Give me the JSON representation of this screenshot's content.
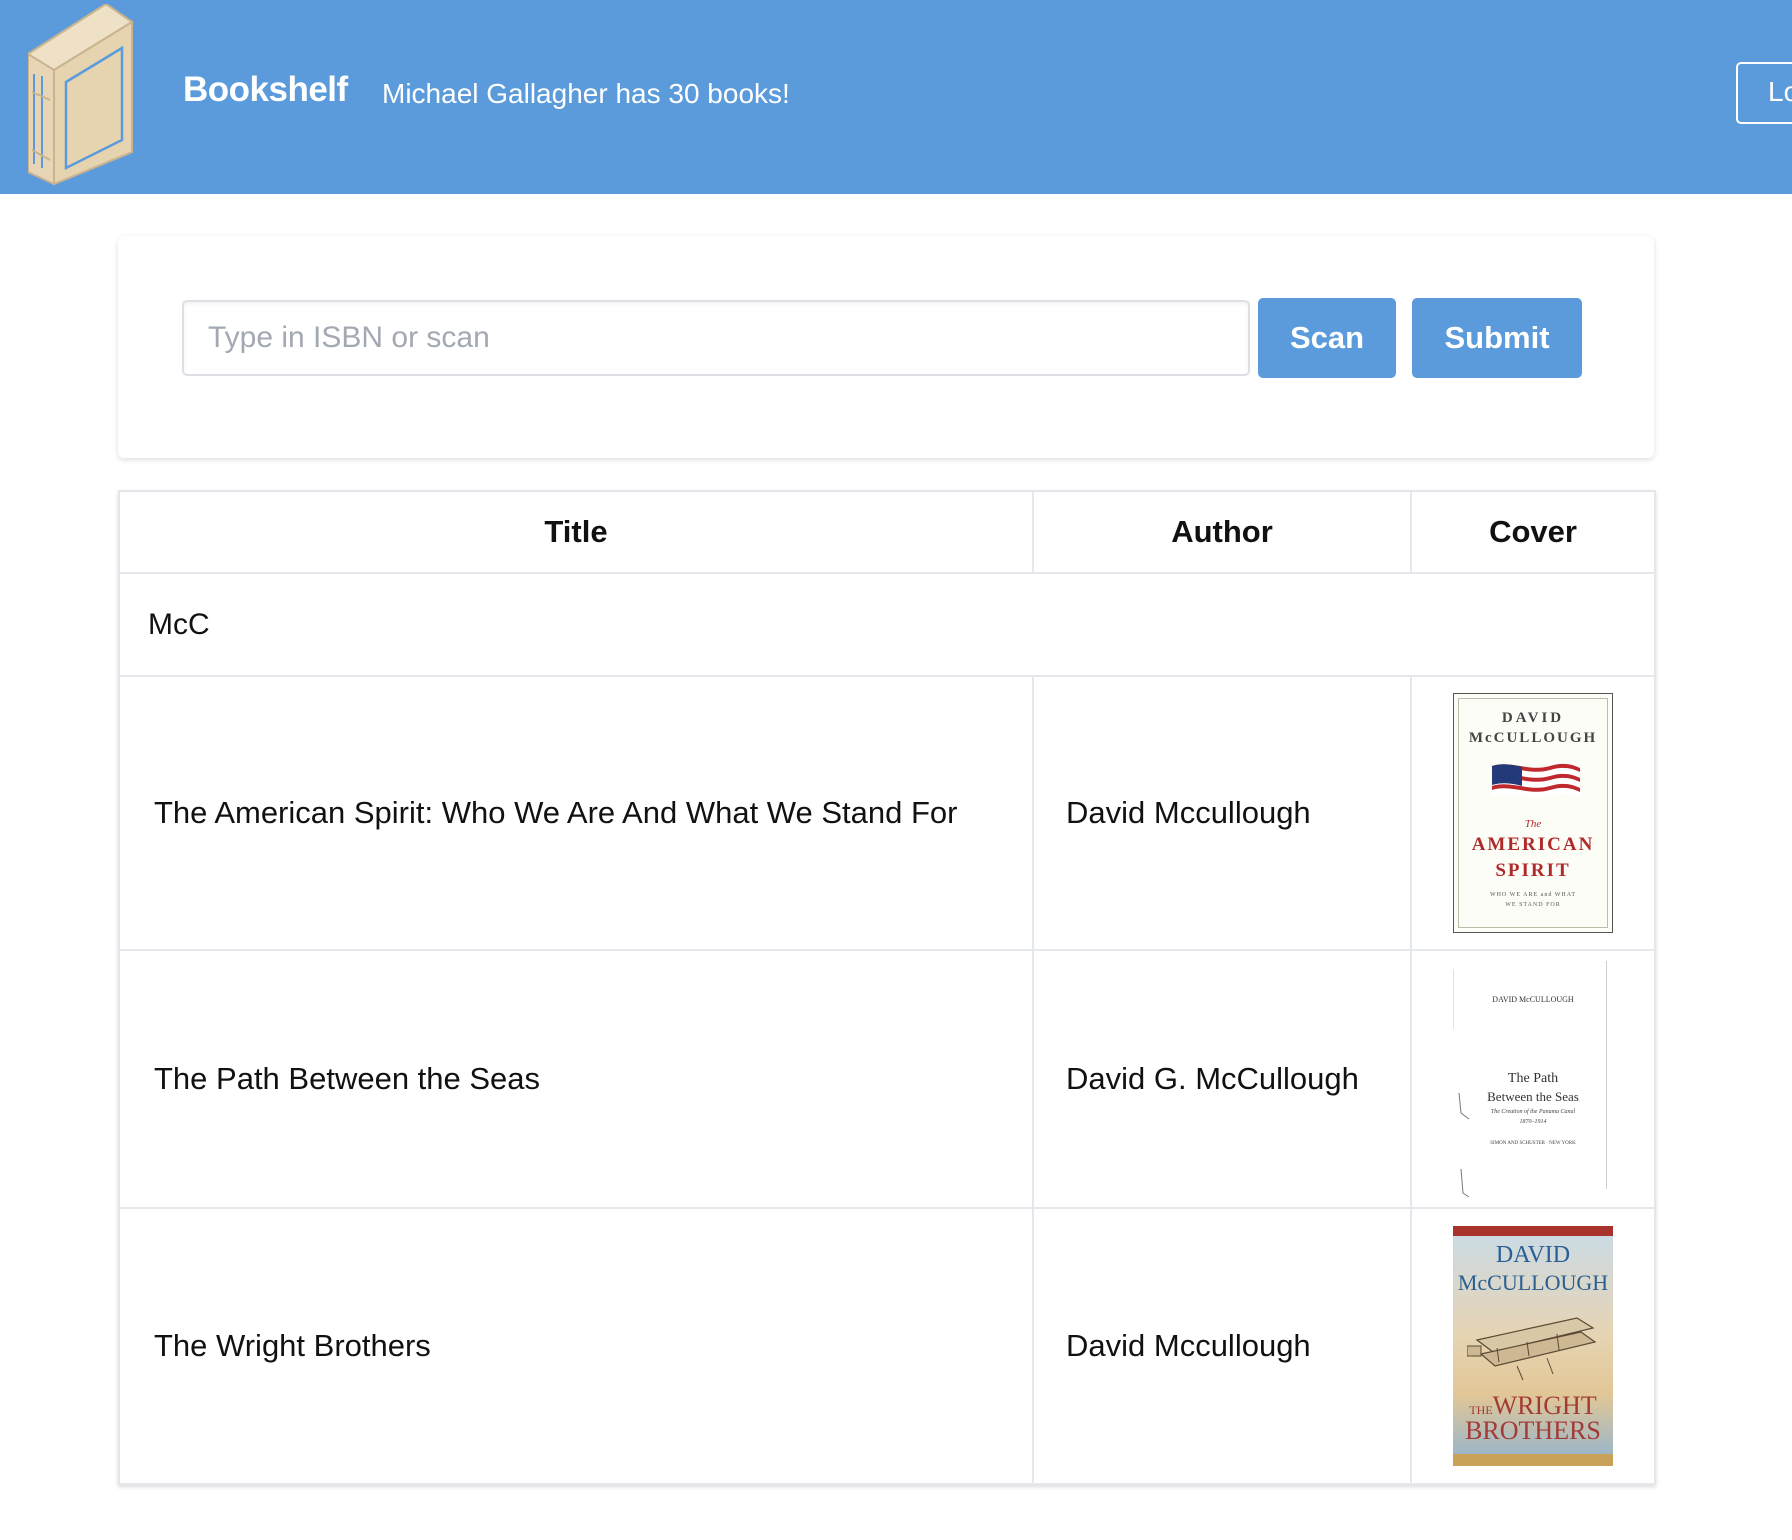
{
  "header": {
    "brand": "Bookshelf",
    "user_message": "Michael Gallagher has 30 books!",
    "logout_label": "Lo",
    "brand_color": "#5b9bdb",
    "logo_icon": "book-icon"
  },
  "search": {
    "placeholder": "Type in ISBN or scan",
    "value": "",
    "scan_label": "Scan",
    "submit_label": "Submit"
  },
  "table": {
    "columns": [
      "Title",
      "Author",
      "Cover"
    ],
    "group_label": "McC",
    "rows": [
      {
        "title": "The American Spirit: Who We Are And What We Stand For",
        "author": "David Mccullough",
        "cover": {
          "author_line1": "DAVID",
          "author_line2": "McCULLOUGH",
          "the": "The",
          "title_line1": "AMERICAN",
          "title_line2": "SPIRIT",
          "subtitle": "WHO WE ARE and WHAT WE STAND FOR"
        }
      },
      {
        "title": "The Path Between the Seas",
        "author": "David G. McCullough",
        "cover": {
          "author_line": "DAVID McCULLOUGH",
          "title_line1": "The Path",
          "title_line2": "Between the Seas",
          "subtitle": "The Creation of the Panama Canal",
          "years": "1870–1914",
          "publisher": "SIMON AND SCHUSTER · NEW YORK"
        }
      },
      {
        "title": "The Wright Brothers",
        "author": "David Mccullough",
        "cover": {
          "author_line1": "DAVID",
          "author_line2": "McCULLOUGH",
          "the": "THE",
          "title_line1": "WRIGHT",
          "title_line2": "BROTHERS"
        }
      }
    ]
  }
}
